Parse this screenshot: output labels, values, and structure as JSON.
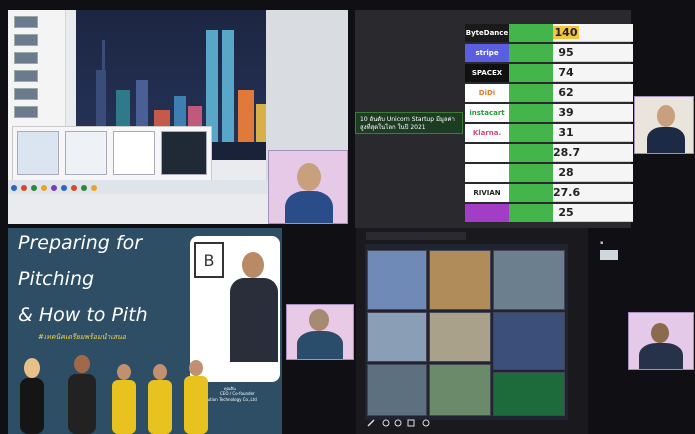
{
  "ranking": {
    "rows": [
      {
        "logo": "ByteDance",
        "number": "140",
        "color": "#1a1a1a",
        "number_bg": "#f4c542"
      },
      {
        "logo": "stripe",
        "number": "95",
        "color": "#5a5ee0"
      },
      {
        "logo": "SPACEX",
        "number": "74",
        "color": "#101010"
      },
      {
        "logo": "DiDi",
        "number": "62",
        "color": "#ffffff"
      },
      {
        "logo": "instacart",
        "number": "39",
        "color": "#ffffff"
      },
      {
        "logo": "Klarna.",
        "number": "31",
        "color": "#ffffff"
      },
      {
        "logo": "",
        "number": "28.7",
        "color": "#ffffff"
      },
      {
        "logo": "",
        "number": "28",
        "color": "#ffffff"
      },
      {
        "logo": "RIVIAN",
        "number": "27.6",
        "color": "#ffffff"
      },
      {
        "logo": "",
        "number": "25",
        "color": "#a23ec6"
      }
    ],
    "header": "10 อันดับ Unicorn Startup มีมูลค่าสูงที่สุดในโลก ในปี 2021"
  },
  "slide": {
    "title_line1": "Preparing for",
    "title_line2": "Pitching",
    "title_line3": "& How to Pith",
    "thai_subtitle": "#เทคนิคเตรียมพร้อมนำเสนอ",
    "speaker_caption_name": "คุณติน",
    "speaker_caption_role": "CEO / Co-founder",
    "speaker_caption_company": "L.B Solution Technology Co.,Ltd"
  },
  "colors": {
    "accent_yellow": "#f3d24a",
    "slide_bg": "#2e4e66",
    "cam_bg": "#d8c9e8"
  }
}
